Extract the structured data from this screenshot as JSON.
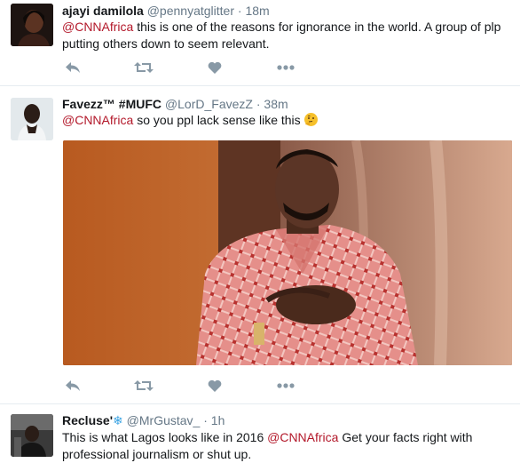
{
  "colors": {
    "mention": "#b3182a",
    "muted": "#657786",
    "icon": "#8899a6"
  },
  "tweets": [
    {
      "name": "ajayi damilola",
      "handle": "@pennyatglitter",
      "sep": "·",
      "time": "18m",
      "mention": "@CNNAfrica",
      "text": " this is one of the reasons for ignorance in the world. A group of plp putting others down to seem relevant."
    },
    {
      "name": "Favezz™ #MUFC",
      "handle": "@LorD_FavezZ",
      "sep": "·",
      "time": "38m",
      "mention": "@CNNAfrica",
      "text": " so you ppl lack sense like this "
    },
    {
      "name": "Recluse'",
      "handle": "@MrGustav_",
      "sep": "·",
      "time": "1h",
      "text_before": "This is what Lagos looks like in 2016 ",
      "mention": "@CNNAfrica",
      "text_after": " Get your facts right with professional journalism or shut up."
    }
  ],
  "icons": [
    "reply-icon",
    "retweet-icon",
    "like-icon",
    "more-icon",
    "location-pin-icon",
    "thinking-emoji-icon",
    "snowflake-icon"
  ]
}
